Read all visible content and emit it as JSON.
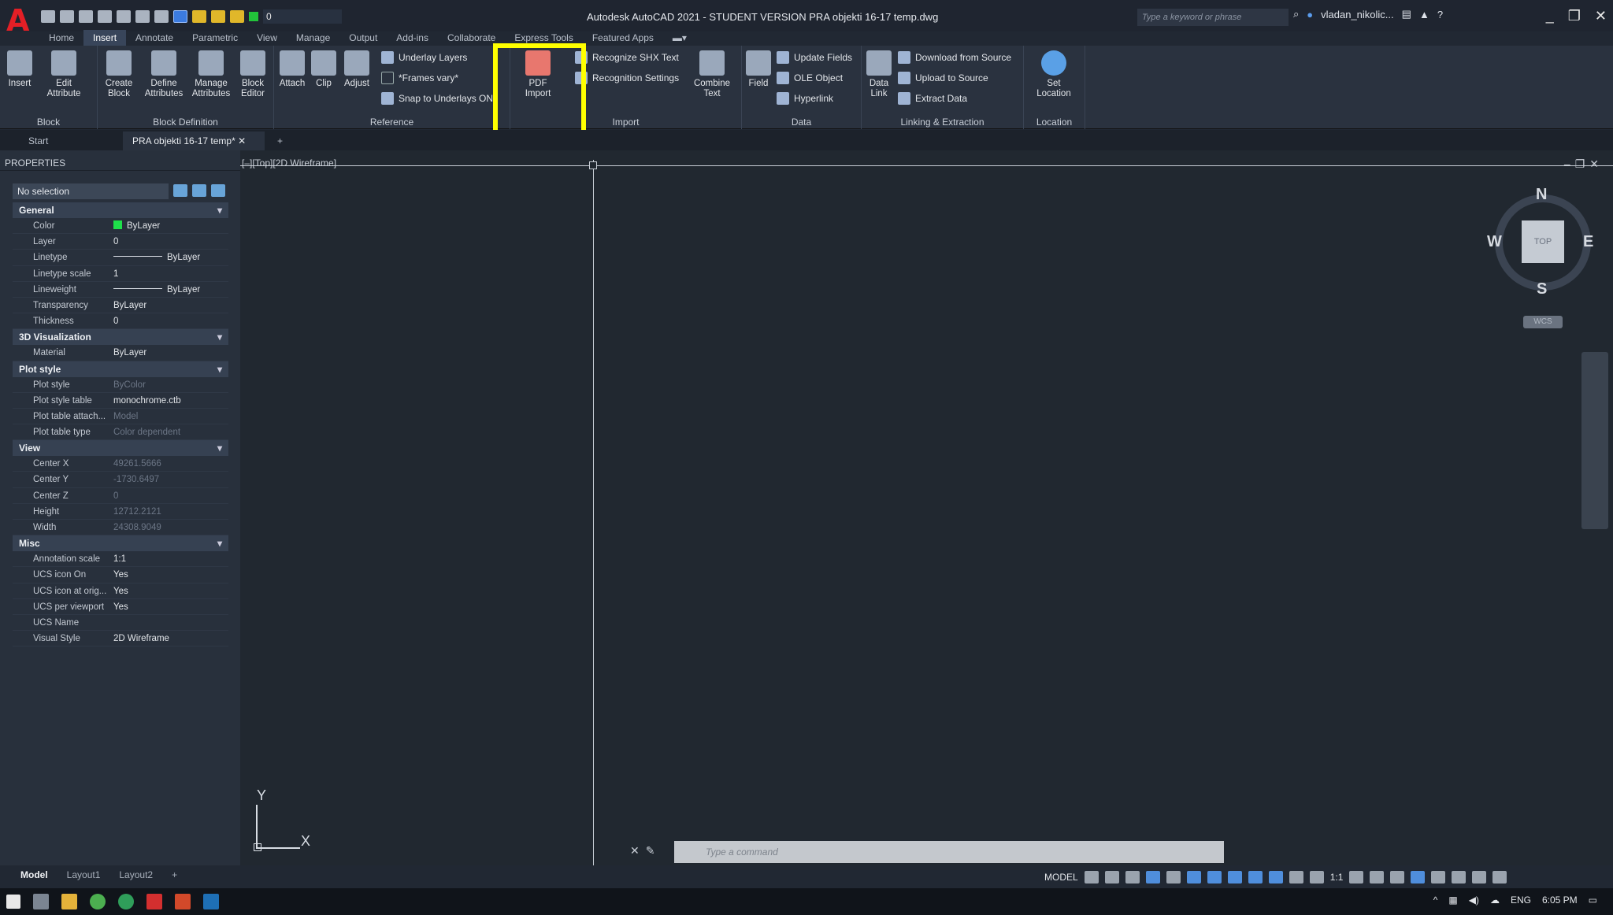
{
  "title_bar": {
    "title": "Autodesk AutoCAD 2021 - STUDENT VERSION    PRA objekti 16-17 temp.dwg",
    "search_placeholder": "Type a keyword or phrase",
    "user": "vladan_nikolic...",
    "layer_value": "0"
  },
  "ribbon_tabs": [
    "Home",
    "Insert",
    "Annotate",
    "Parametric",
    "View",
    "Manage",
    "Output",
    "Add-ins",
    "Collaborate",
    "Express Tools",
    "Featured Apps"
  ],
  "ribbon": {
    "block_panel": {
      "title": "Block",
      "insert": "Insert",
      "edit_attribute": "Edit Attribute"
    },
    "block_def_panel": {
      "title": "Block Definition",
      "create_block": "Create Block",
      "define_attributes": "Define Attributes",
      "manage_attributes": "Manage Attributes",
      "block_editor": "Block Editor"
    },
    "reference_panel": {
      "title": "Reference",
      "attach": "Attach",
      "clip": "Clip",
      "adjust": "Adjust",
      "underlay_layers": "Underlay Layers",
      "frames": "*Frames vary*",
      "snap_underlays": "Snap to Underlays ON"
    },
    "import_panel": {
      "title": "Import",
      "pdf_import": "PDF Import",
      "recognize_shx": "Recognize SHX Text",
      "recognition_settings": "Recognition Settings",
      "combine_text": "Combine Text"
    },
    "data_panel": {
      "title": "Data",
      "field": "Field",
      "update_fields": "Update Fields",
      "ole_object": "OLE Object",
      "hyperlink": "Hyperlink"
    },
    "linking_panel": {
      "title": "Linking & Extraction",
      "data_link": "Data Link",
      "download_source": "Download from Source",
      "upload_source": "Upload to Source",
      "extract_data": "Extract  Data"
    },
    "location_panel": {
      "title": "Location",
      "set_location": "Set Location"
    }
  },
  "file_tabs": {
    "start": "Start",
    "current": "PRA objekti 16-17 temp*",
    "add": "+"
  },
  "properties": {
    "title": "PROPERTIES",
    "selection": "No selection",
    "sections": {
      "general": {
        "title": "General",
        "rows": [
          {
            "name": "Color",
            "value": "ByLayer"
          },
          {
            "name": "Layer",
            "value": "0"
          },
          {
            "name": "Linetype",
            "value": "ByLayer"
          },
          {
            "name": "Linetype scale",
            "value": "1"
          },
          {
            "name": "Lineweight",
            "value": "ByLayer"
          },
          {
            "name": "Transparency",
            "value": "ByLayer"
          },
          {
            "name": "Thickness",
            "value": "0"
          }
        ]
      },
      "viz3d": {
        "title": "3D Visualization",
        "rows": [
          {
            "name": "Material",
            "value": "ByLayer"
          }
        ]
      },
      "plot": {
        "title": "Plot style",
        "rows": [
          {
            "name": "Plot style",
            "value": "ByColor"
          },
          {
            "name": "Plot style table",
            "value": "monochrome.ctb"
          },
          {
            "name": "Plot table attach...",
            "value": "Model"
          },
          {
            "name": "Plot table type",
            "value": "Color dependent"
          }
        ]
      },
      "view": {
        "title": "View",
        "rows": [
          {
            "name": "Center X",
            "value": "49261.5666"
          },
          {
            "name": "Center Y",
            "value": "-1730.6497"
          },
          {
            "name": "Center Z",
            "value": "0"
          },
          {
            "name": "Height",
            "value": "12712.2121"
          },
          {
            "name": "Width",
            "value": "24308.9049"
          }
        ]
      },
      "misc": {
        "title": "Misc",
        "rows": [
          {
            "name": "Annotation scale",
            "value": "1:1"
          },
          {
            "name": "UCS icon On",
            "value": "Yes"
          },
          {
            "name": "UCS icon at orig...",
            "value": "Yes"
          },
          {
            "name": "UCS per viewport",
            "value": "Yes"
          },
          {
            "name": "UCS Name",
            "value": ""
          },
          {
            "name": "Visual Style",
            "value": "2D Wireframe"
          }
        ]
      }
    }
  },
  "viewport": {
    "label": "[–][Top][2D Wireframe]"
  },
  "viewcube": {
    "n": "N",
    "s": "S",
    "e": "E",
    "w": "W",
    "face": "TOP",
    "wcs": "WCS"
  },
  "ucs": {
    "x": "X",
    "y": "Y"
  },
  "command": {
    "placeholder": "Type a command"
  },
  "layout_tabs": [
    "Model",
    "Layout1",
    "Layout2",
    "+"
  ],
  "status": {
    "model": "MODEL",
    "scale": "1:1"
  },
  "tray": {
    "lang": "ENG",
    "time": "6:05 PM"
  }
}
